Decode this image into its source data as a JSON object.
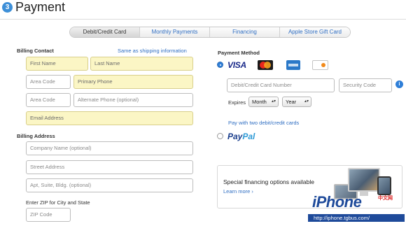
{
  "header": {
    "step": "3",
    "title": "Payment"
  },
  "tabs": [
    {
      "label": "Debit/Credit Card",
      "active": true
    },
    {
      "label": "Monthly Payments",
      "active": false
    },
    {
      "label": "Financing",
      "active": false
    },
    {
      "label": "Apple Store Gift Card",
      "active": false
    }
  ],
  "billing_contact": {
    "title": "Billing Contact",
    "same_as_shipping": "Same as shipping information",
    "first_name": "First Name",
    "last_name": "Last Name",
    "area_code": "Area Code",
    "primary_phone": "Primary Phone",
    "area_code_2": "Area Code",
    "alternate_phone": "Alternate Phone (optional)",
    "email": "Email Address"
  },
  "billing_address": {
    "title": "Billing Address",
    "company": "Company Name (optional)",
    "street": "Street Address",
    "apt": "Apt, Suite, Bldg. (optional)",
    "zip_label": "Enter ZIP for City and State",
    "zip": "ZIP Code"
  },
  "payment_method": {
    "title": "Payment Method",
    "card_logos": [
      "visa-logo",
      "mastercard-logo",
      "amex-logo",
      "discover-logo"
    ],
    "visa_text": "VISA",
    "card_number": "Debit/Credit Card Number",
    "security_code": "Security Code",
    "expires_label": "Expires",
    "month": "Month",
    "year": "Year",
    "two_cards_link": "Pay with two debit/credit cards",
    "paypal_pay": "Pay",
    "paypal_pal": "Pal"
  },
  "promo": {
    "text": "Special financing options available",
    "link": "Learn more ›"
  },
  "watermark": {
    "logo": "iPhone",
    "cn": "中文网",
    "url": "http://iphone.tgbus.com/"
  },
  "colors": {
    "accent": "#2f6ec2",
    "required_bg": "#fbf6c5",
    "radio_on": "#2f7fd8"
  }
}
